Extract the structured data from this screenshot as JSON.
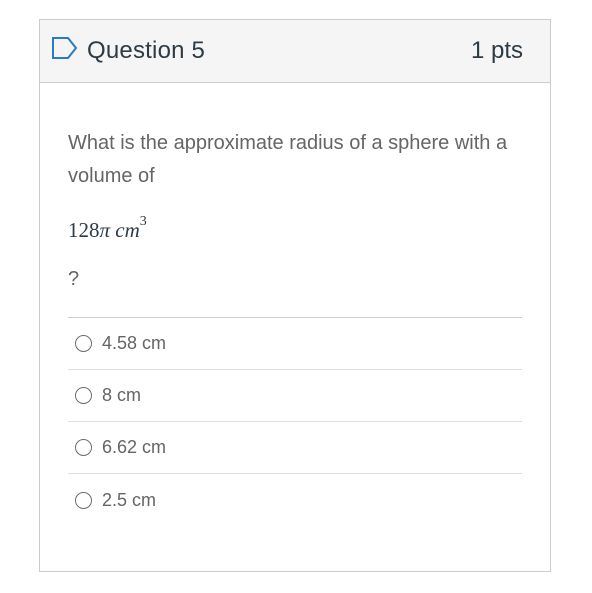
{
  "question": {
    "title": "Question 5",
    "points": "1 pts",
    "text": "What is the approximate radius of a sphere with a volume of",
    "math": {
      "coefficient": "128",
      "symbol": "π",
      "unit": "cm",
      "exponent": "3"
    },
    "suffix": "?",
    "answers": [
      {
        "label": "4.58 cm",
        "selected": false
      },
      {
        "label": "8 cm",
        "selected": false
      },
      {
        "label": "6.62 cm",
        "selected": false
      },
      {
        "label": "2.5 cm",
        "selected": false
      }
    ]
  },
  "icons": {
    "flag": "bookmark-outline-icon"
  },
  "colors": {
    "bookmark": "#2d7bbf",
    "header_bg": "#f5f5f5",
    "border": "#c7cdd1",
    "text_muted": "#656565"
  }
}
